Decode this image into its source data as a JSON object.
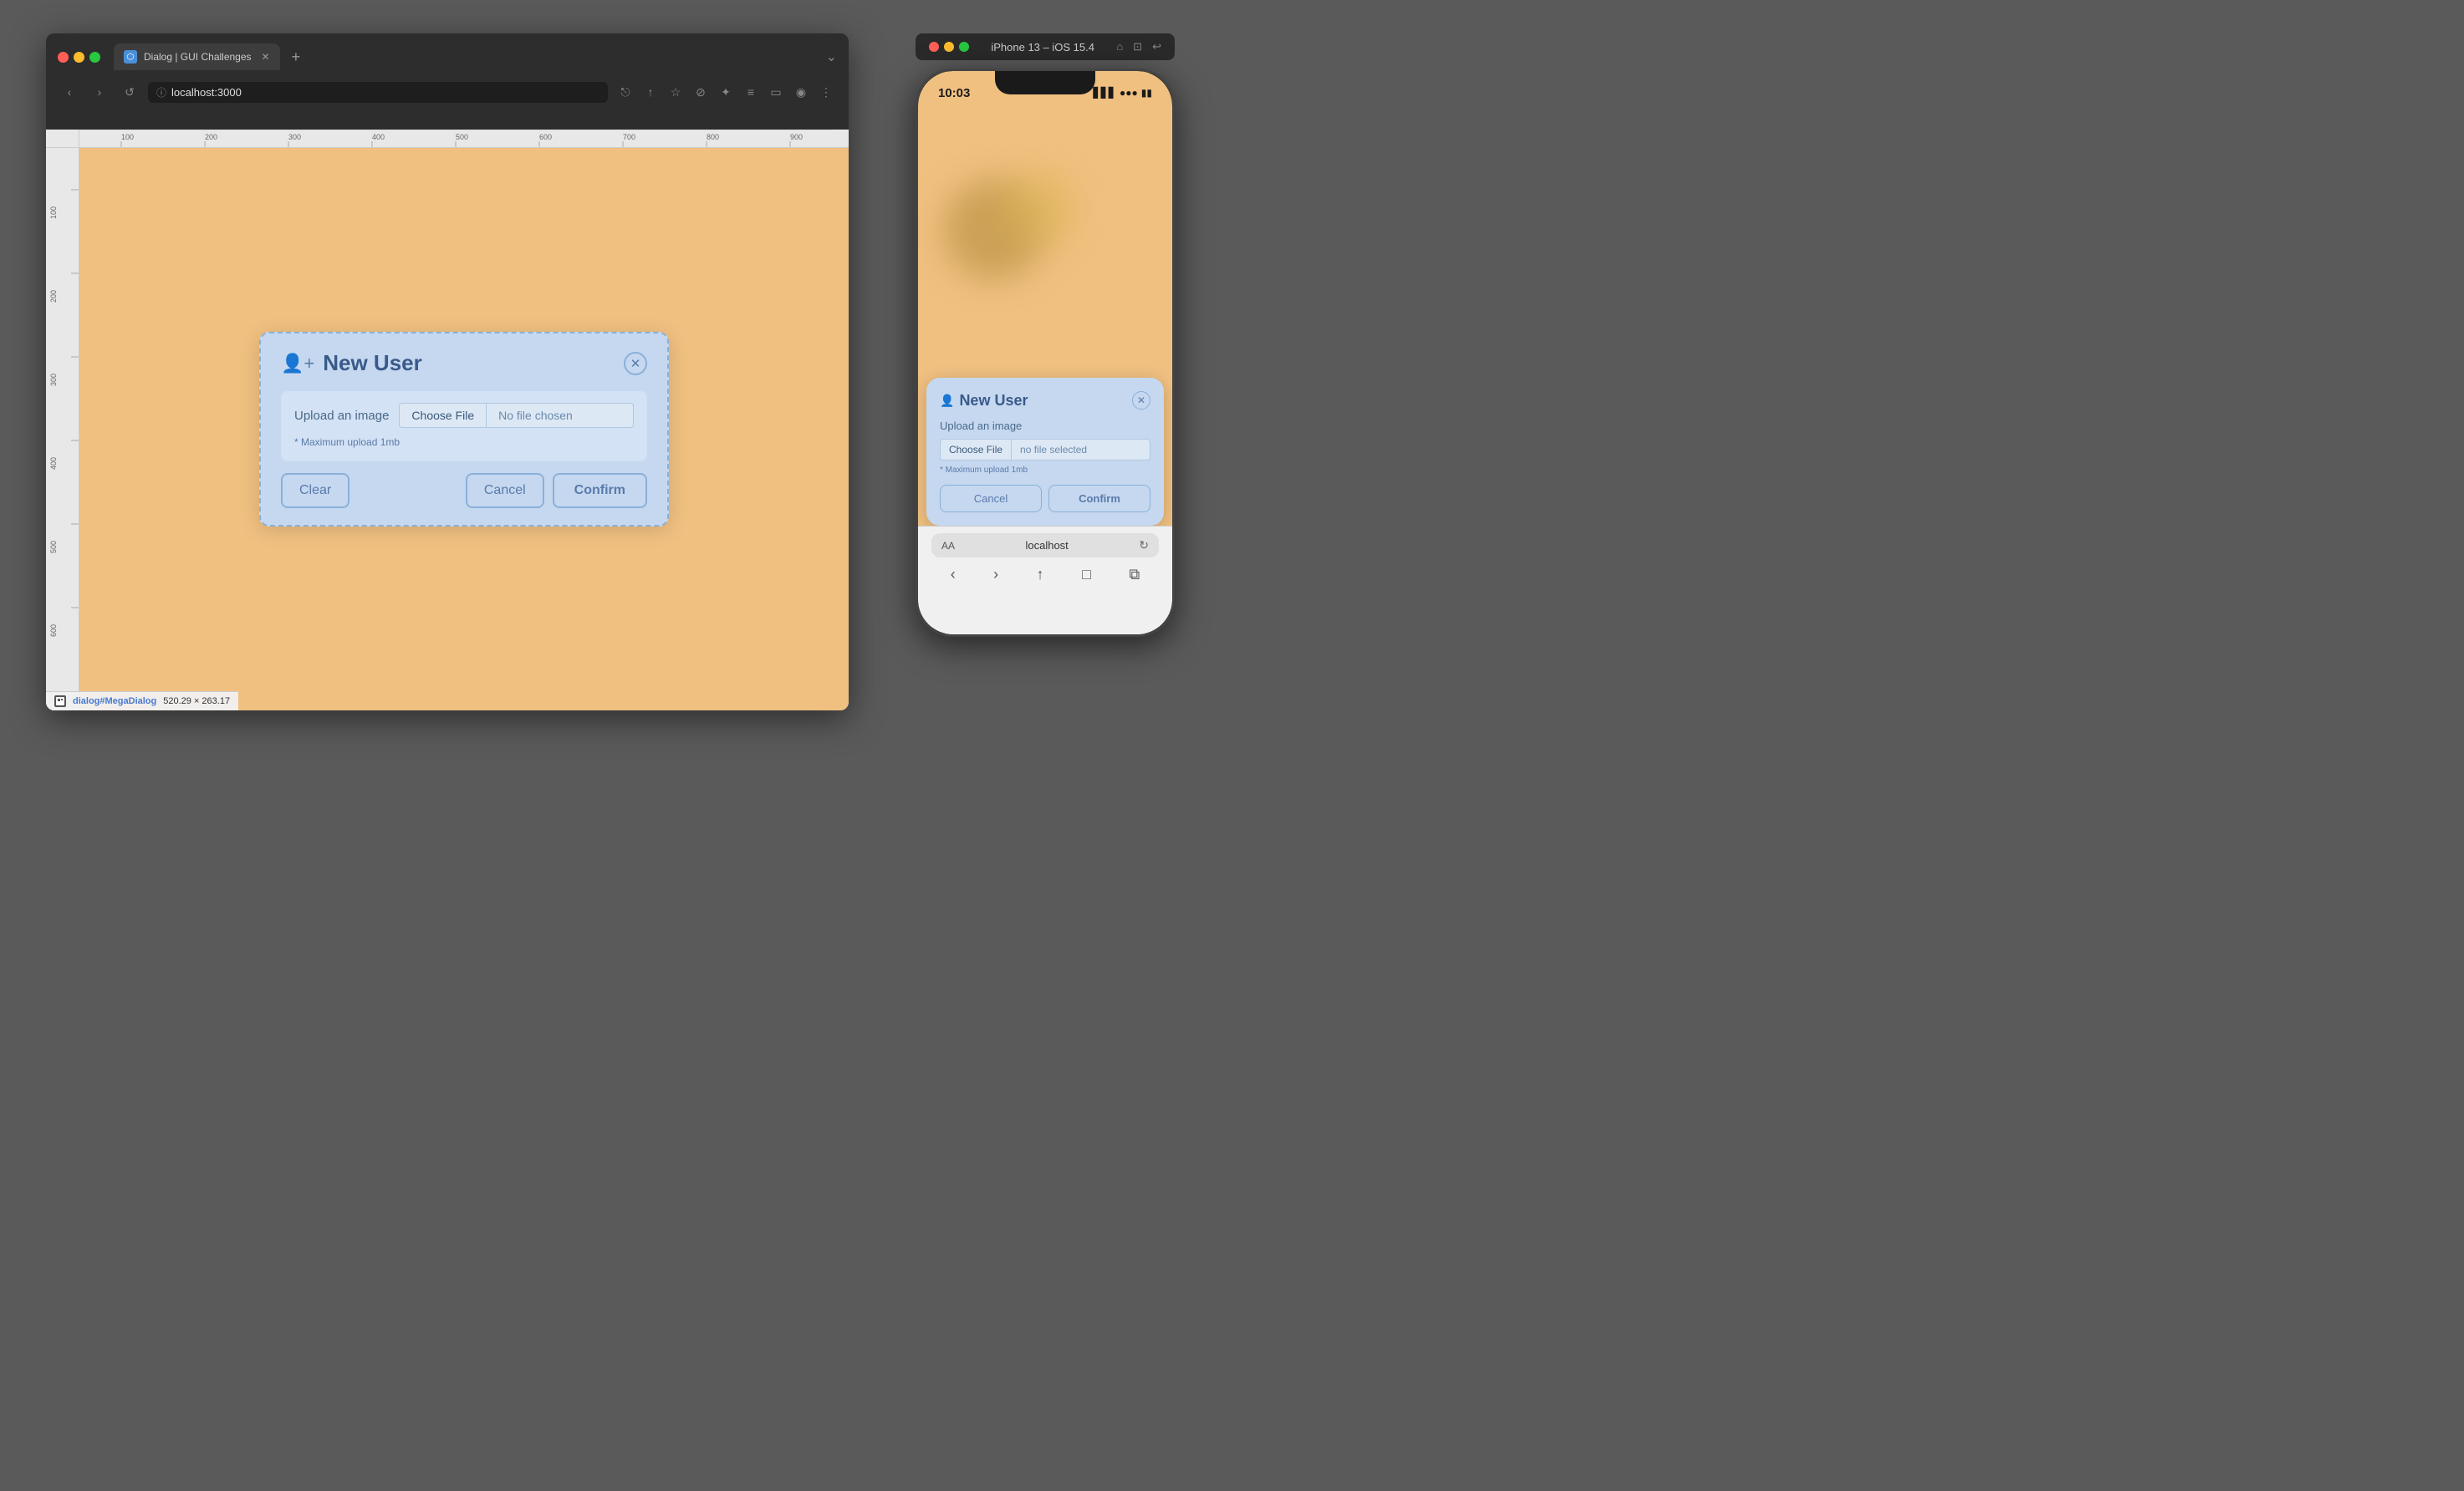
{
  "browser": {
    "tab_title": "Dialog | GUI Challenges",
    "url": "localhost:3000",
    "dialog": {
      "title": "New User",
      "upload_label": "Upload an image",
      "choose_file_btn": "Choose File",
      "no_file_text": "No file chosen",
      "upload_hint": "* Maximum upload 1mb",
      "clear_btn": "Clear",
      "cancel_btn": "Cancel",
      "confirm_btn": "Confirm"
    },
    "status": {
      "selector": "dialog#MegaDialog",
      "dimensions": "520.29 × 263.17"
    }
  },
  "iphone": {
    "device_label": "iPhone 13 – iOS 15.4",
    "time": "10:03",
    "dialog": {
      "title": "New User",
      "upload_label": "Upload an image",
      "choose_file_btn": "Choose File",
      "no_file_text": "no file selected",
      "upload_hint": "* Maximum upload 1mb",
      "cancel_btn": "Cancel",
      "confirm_btn": "Confirm"
    },
    "browser_bar": {
      "url": "localhost",
      "aa_label": "AA"
    }
  }
}
